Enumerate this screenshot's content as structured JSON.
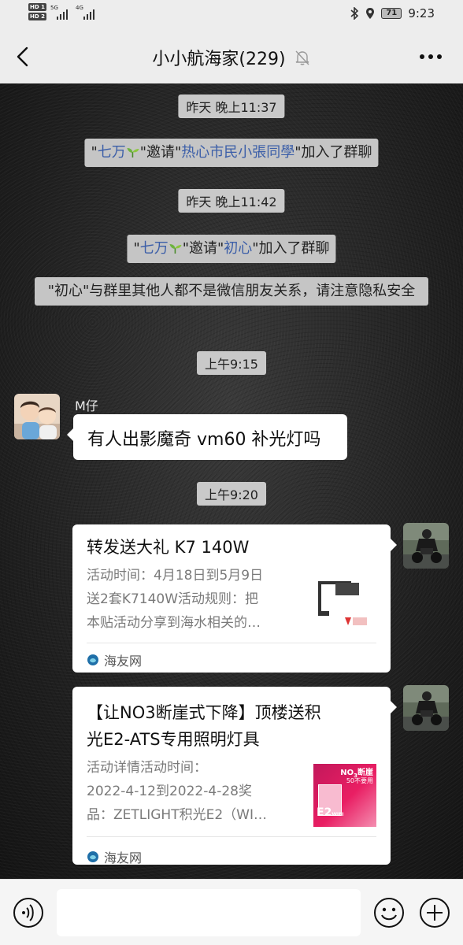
{
  "status_bar": {
    "sim1": "HD 1",
    "sim2": "HD 2",
    "net1": "5G",
    "net2": "4G",
    "battery": "71",
    "time": "9:23"
  },
  "header": {
    "title": "小小航海家(229)"
  },
  "messages": {
    "time1": "昨天 晚上11:37",
    "sys1": {
      "q1": "\"",
      "inviter": "七万",
      "q2": "\"邀请\"",
      "invitee": "热心市民小張同學",
      "tail": "\"加入了群聊"
    },
    "time2": "昨天 晚上11:42",
    "sys2": {
      "q1": "\"",
      "inviter": "七万",
      "q2": "\"邀请\"",
      "invitee": "初心",
      "tail": "\"加入了群聊"
    },
    "sys3": "\"初心\"与群里其他人都不是微信朋友关系，请注意隐私安全",
    "time3": "上午9:15",
    "msg1": {
      "sender": "M仔",
      "text": "有人出影魔奇 vm60 补光灯吗"
    },
    "time4": "上午9:20",
    "card1": {
      "title": "转发送大礼 K7 140W",
      "desc1": "活动时间：4月18日到5月9日",
      "desc2": "送2套K7140W活动规则：把",
      "desc3": "本贴活动分享到海水相关的…",
      "source": "海友网"
    },
    "card2": {
      "title1": "【让NO3断崖式下降】顶楼送积",
      "title2": "光E2-ATS专用照明灯具",
      "desc1": "活动详情活动时间：",
      "desc2": "2022-4-12到2022-4-28奖",
      "desc3": "品：ZETLIGHT积光E2（WI…",
      "source": "海友网",
      "thumb_text1": "NO",
      "thumb_text2": "3",
      "thumb_text3": "断崖",
      "thumb_text4": "50不要用",
      "thumb_text5": "E2",
      "thumb_text6": "WIFI"
    }
  },
  "colors": {
    "link": "#3b5ea8",
    "pill": "#c9c9c9",
    "bar": "#ededed"
  },
  "icons": {
    "back": "chevron-left-icon",
    "mute": "bell-off-icon",
    "more": "more-dots-icon",
    "voice": "voice-icon",
    "emoji": "emoji-icon",
    "plus": "plus-icon"
  }
}
